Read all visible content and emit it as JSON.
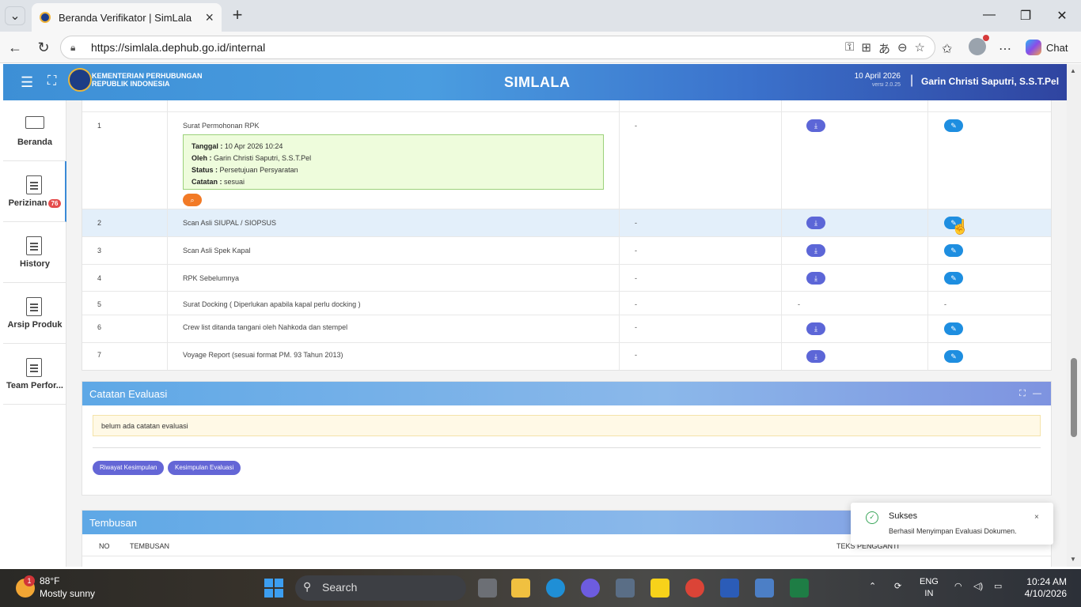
{
  "browser": {
    "tab_title": "Beranda Verifikator | SimLala",
    "url": "https://simlala.dephub.go.id/internal",
    "chat_label": "Chat"
  },
  "header": {
    "ministry_line1": "KEMENTERIAN PERHUBUNGAN",
    "ministry_line2": "REPUBLIK INDONESIA",
    "app_title": "SIMLALA",
    "date": "10 April 2026",
    "version": "versi 2.0.25",
    "user": "Garin Christi Saputri, S.S.T.Pel"
  },
  "sidebar": {
    "items": [
      {
        "label": "Beranda",
        "icon": "monitor-icon"
      },
      {
        "label": "Perizinan",
        "icon": "document-icon",
        "badge": "76"
      },
      {
        "label": "History",
        "icon": "document-icon"
      },
      {
        "label": "Arsip Produk",
        "icon": "document-icon"
      },
      {
        "label": "Team Perfor...",
        "icon": "document-icon"
      }
    ]
  },
  "documents": {
    "rows": [
      {
        "no": "1",
        "name": "Surat Permohonan RPK",
        "ket": "-",
        "download": true,
        "edit": true
      },
      {
        "no": "2",
        "name": "Scan Asli SIUPAL / SIOPSUS",
        "ket": "-",
        "download": true,
        "edit": true
      },
      {
        "no": "3",
        "name": "Scan Asli Spek Kapal",
        "ket": "-",
        "download": true,
        "edit": true
      },
      {
        "no": "4",
        "name": "RPK Sebelumnya",
        "ket": "-",
        "download": true,
        "edit": true
      },
      {
        "no": "5",
        "name": "Surat Docking ( Diperlukan apabila kapal perlu docking )",
        "ket": "-",
        "download_text": "-",
        "edit_text": "-"
      },
      {
        "no": "6",
        "name": "Crew list ditanda tangani oleh Nahkoda dan stempel",
        "ket": "-",
        "download": true,
        "edit": true
      },
      {
        "no": "7",
        "name": "Voyage Report (sesuai format PM. 93 Tahun 2013)",
        "ket": "-",
        "download": true,
        "edit": true
      }
    ],
    "evaluation": {
      "tanggal_label": "Tanggal :",
      "tanggal": "10 Apr 2026 10:24",
      "oleh_label": "Oleh :",
      "oleh": "Garin Christi Saputri, S.S.T.Pel",
      "status_label": "Status :",
      "status": "Persetujuan Persyaratan",
      "catatan_label": "Catatan :",
      "catatan": "sesuai"
    }
  },
  "catatan_evaluasi": {
    "title": "Catatan Evaluasi",
    "note": "belum ada catatan evaluasi",
    "btn_riwayat": "Riwayat Kesimpulan",
    "btn_kesimpulan": "Kesimpulan Evaluasi"
  },
  "tembusan": {
    "title": "Tembusan",
    "col_no": "NO",
    "col_tembusan": "TEMBUSAN",
    "col_teks": "TEKS PENGGANTI"
  },
  "toast": {
    "title": "Sukses",
    "message": "Berhasil Menyimpan Evaluasi Dokumen.",
    "close": "×"
  },
  "taskbar": {
    "weather_badge": "1",
    "temperature": "88°F",
    "weather": "Mostly sunny",
    "search_placeholder": "Search",
    "lang1": "ENG",
    "lang2": "IN",
    "time": "10:24 AM",
    "date": "4/10/2026"
  }
}
